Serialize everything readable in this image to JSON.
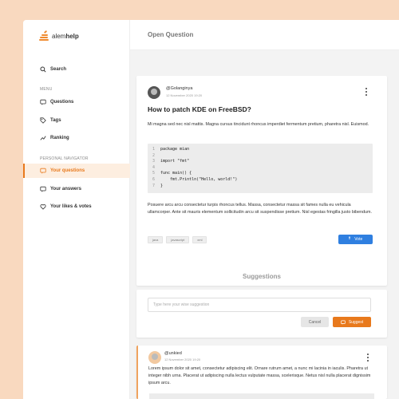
{
  "app": {
    "logo_light": "alem",
    "logo_bold": "help",
    "header_title": "Open Question"
  },
  "sidebar": {
    "search": "Search",
    "menu_label": "MENU",
    "menu": [
      {
        "label": "Questions",
        "icon": "questions-icon"
      },
      {
        "label": "Tags",
        "icon": "tag-icon"
      },
      {
        "label": "Ranking",
        "icon": "ranking-icon"
      }
    ],
    "personal_label": "PERSONAL NAVIGATOR",
    "personal": [
      {
        "label": "Your questions",
        "icon": "questions-icon",
        "active": true
      },
      {
        "label": "Your answers",
        "icon": "answers-icon"
      },
      {
        "label": "Your likes & votes",
        "icon": "heart-icon"
      }
    ]
  },
  "question": {
    "username": "@Golanginya",
    "date": "12 November 2020 19:20",
    "title": "How to patch KDE on FreeBSD?",
    "body": "Mi magna sed nec nisl mattis. Magna cursus tincidunt rhoncus imperdiet fermentum pretium, pharetra nisl. Euismod.",
    "code": [
      {
        "n": "1",
        "text": "package mian"
      },
      {
        "n": "2",
        "text": ""
      },
      {
        "n": "3",
        "text": "import \"fmt\""
      },
      {
        "n": "4",
        "text": ""
      },
      {
        "n": "5",
        "text": "func main() {"
      },
      {
        "n": "6",
        "text": "    fmt.Println(\"Hello, world!\")"
      },
      {
        "n": "7",
        "text": "}"
      }
    ],
    "body2": "Posuere arcu arcu consectetur turpis rhoncus tellus. Massa, consectetur massa sit fames nulla eu vehicula ullamcorper. Ante sit mauris elementum sollicitudin arcu sit suspendisse pretium. Nisl egestas fringilla justo bibendum.",
    "tags": [
      "java",
      "javascript",
      "xml"
    ],
    "vote_label": "Vote"
  },
  "suggestions": {
    "heading": "Suggestions",
    "placeholder": "Type here your wise suggestion",
    "cancel_label": "Cancel",
    "suggest_label": "Suggest"
  },
  "answer": {
    "username": "@unkied",
    "date": "12 November 2020 19:20",
    "body": "Lorem ipsum dolor sit amet, consectetur adipiscing elit. Ornare rutrum amet, a nunc mi lacinia in iaculis. Pharetra ut integer nibh urna. Placerat ut adipiscing nulla lectus vulputate massa, scelerisque. Netus nisl nulla placerat dignissim ipsum arcu."
  },
  "colors": {
    "background": "#f9d9bf",
    "accent": "#e8791c",
    "vote": "#2f7fe0"
  }
}
